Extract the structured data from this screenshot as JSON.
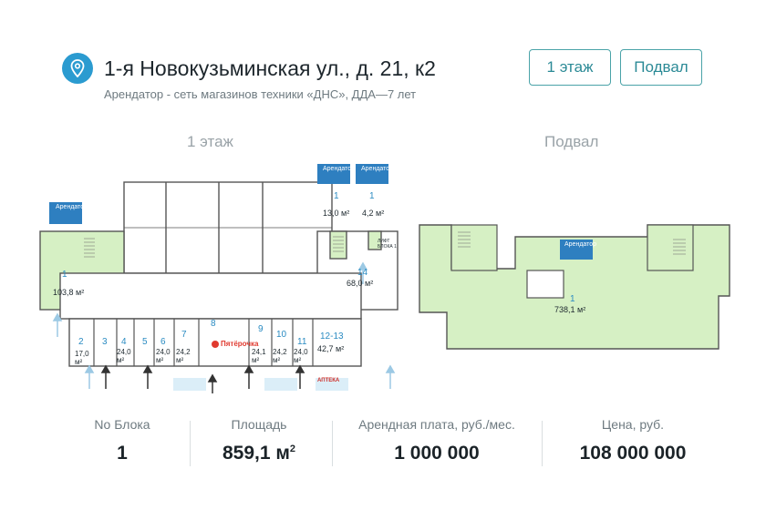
{
  "header": {
    "address": "1-я Новокузьминская ул., д. 21, к2",
    "subtitle": "Арендатор - сеть магазинов техники «ДНС», ДДА—7 лет",
    "buttons": {
      "floor1": "1 этаж",
      "basement": "Подвал"
    }
  },
  "plans": {
    "floor1": {
      "title": "1 этаж",
      "tenant_badge": "Арендатор",
      "brand": "DNS",
      "lift_label": "ЛИФТ БЛОКА 1",
      "rooms": [
        {
          "no": "1",
          "area": "103,8 м²"
        },
        {
          "no": "1",
          "area": "13,0 м²"
        },
        {
          "no": "1",
          "area": "4,2 м²"
        },
        {
          "no": "14",
          "area": "68,0 м²"
        },
        {
          "no": "8",
          "area": ""
        },
        {
          "no": "2",
          "area": "17,0 м²"
        },
        {
          "no": "3",
          "area": ""
        },
        {
          "no": "4",
          "area": "24,0 м²"
        },
        {
          "no": "5",
          "area": ""
        },
        {
          "no": "6",
          "area": "24,0 м²"
        },
        {
          "no": "7",
          "area": "24,2 м²"
        },
        {
          "no": "9",
          "area": "24,1 м²"
        },
        {
          "no": "10",
          "area": "24,2 м²"
        },
        {
          "no": "11",
          "area": "24,0 м²"
        },
        {
          "no": "12-13",
          "area": "42,7 м²"
        }
      ],
      "shop_labels": {
        "pyaterochka": "Пятёрочка",
        "apteka": "АПТЕКА"
      }
    },
    "basement": {
      "title": "Подвал",
      "tenant_badge": "Арендатор",
      "brand": "DNS",
      "room": {
        "no": "1",
        "area": "738,1 м²"
      }
    }
  },
  "stats": [
    {
      "label": "No Блока",
      "value": "1"
    },
    {
      "label": "Площадь",
      "value": "859,1 м",
      "sup": "2"
    },
    {
      "label": "Арендная плата, руб./мес.",
      "value": "1 000 000"
    },
    {
      "label": "Цена, руб.",
      "value": "108 000 000"
    }
  ],
  "colors": {
    "accent": "#2b9bd0",
    "button": "#4aa3a8",
    "rented": "#d6f0c4",
    "label": "#3a8fc4"
  }
}
